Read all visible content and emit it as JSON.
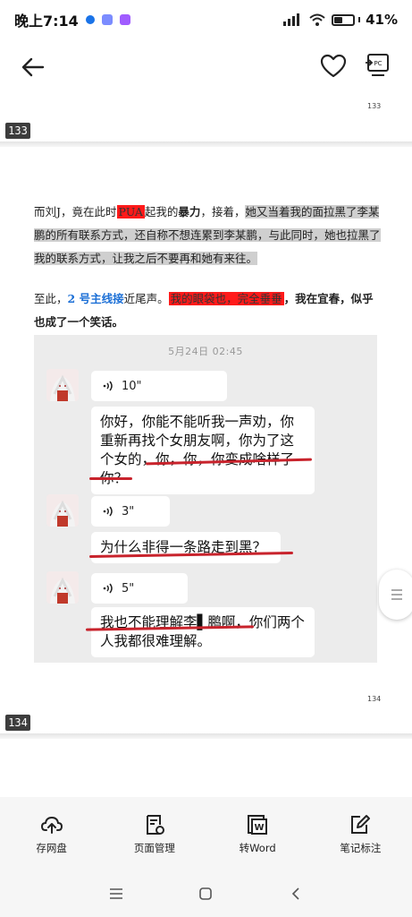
{
  "status_bar": {
    "time": "晚上7:14",
    "battery": "41%"
  },
  "page_markers": {
    "top_small": "133",
    "top_tag": "133",
    "bottom_small": "134",
    "bottom_tag": "134"
  },
  "article": {
    "p1_a": "而刘",
    "p1_b": "J，竟在此时",
    "p1_pua": "PUA",
    "p1_c": "起我的",
    "p1_bold": "暴力",
    "p1_d": "，接着，",
    "p1_gray": "她又当着我的面拉黑了李某鹏的所有联系方式，还自称不想连累到李某鹏，与此同时，她也拉黑了我的联系方式，让我之后不要再和她有来往。",
    "p2_a": "至此，",
    "p2_blue": "2 号主线接",
    "p2_b": "近尾声。",
    "p2_red": "我的眼袋也，完全垂垂",
    "p2_bold": "，我在宜春，似乎也成了一个笑话。"
  },
  "chat": {
    "timestamp": "5月24日 02:45",
    "messages": [
      {
        "duration": "10\"",
        "text": "你好，你能不能听我一声劝，你重新再找个女朋友啊，你为了这个女的，你，你，你变成啥样了你？"
      },
      {
        "duration": "3\"",
        "text": "为什么非得一条路走到黑？"
      },
      {
        "duration": "5\"",
        "text": "我也不能理解李▌鹏啊，你们两个人我都很难理解。"
      }
    ]
  },
  "toolbar": [
    {
      "label": "存网盘",
      "icon": "cloud-upload-icon"
    },
    {
      "label": "页面管理",
      "icon": "page-settings-icon"
    },
    {
      "label": "转Word",
      "icon": "word-convert-icon"
    },
    {
      "label": "笔记标注",
      "icon": "edit-note-icon"
    }
  ]
}
